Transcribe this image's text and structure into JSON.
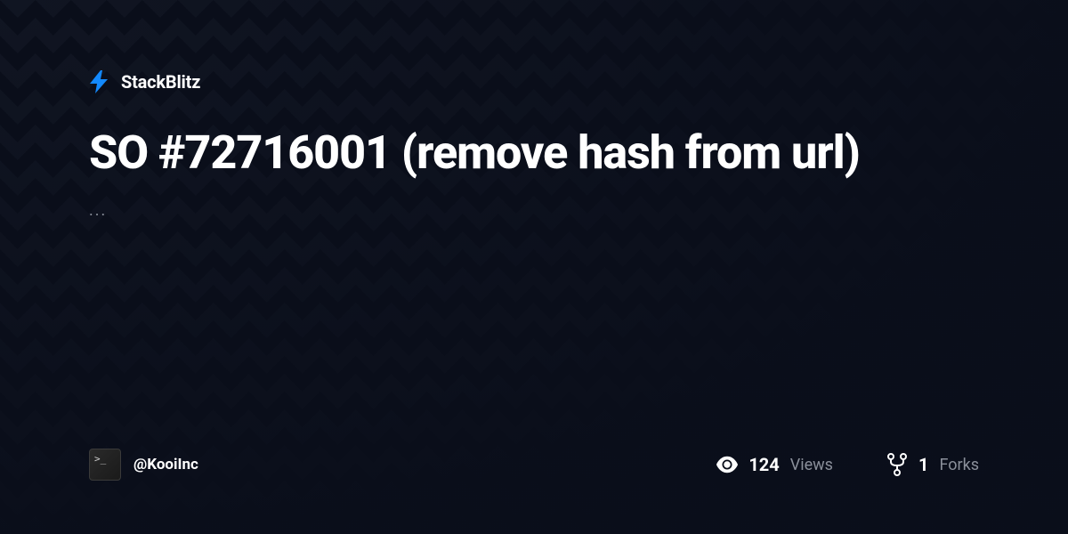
{
  "brand": {
    "name": "StackBlitz"
  },
  "project": {
    "title": "SO #72716001 (remove hash from url)",
    "description": "..."
  },
  "author": {
    "username": "@KooiInc"
  },
  "stats": {
    "views": {
      "count": "124",
      "label": "Views"
    },
    "forks": {
      "count": "1",
      "label": "Forks"
    }
  }
}
